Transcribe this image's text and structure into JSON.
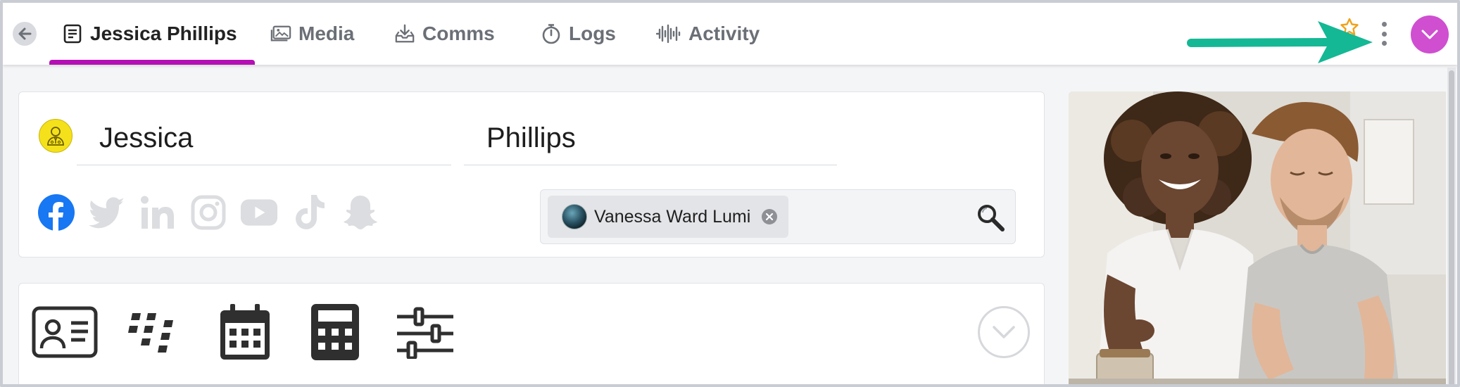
{
  "tabs": [
    {
      "label": "Jessica Phillips",
      "icon": "document-icon",
      "active": true
    },
    {
      "label": "Media",
      "icon": "image-icon",
      "active": false
    },
    {
      "label": "Comms",
      "icon": "inbox-download-icon",
      "active": false
    },
    {
      "label": "Logs",
      "icon": "stopwatch-icon",
      "active": false
    },
    {
      "label": "Activity",
      "icon": "waveform-icon",
      "active": false
    }
  ],
  "contact": {
    "first_name": "Jessica",
    "last_name": "Phillips"
  },
  "social_networks": [
    "facebook",
    "twitter",
    "linkedin",
    "instagram",
    "youtube",
    "tiktok",
    "snapchat"
  ],
  "linked_contact": {
    "name": "Vanessa Ward Lumi"
  },
  "tools": [
    "id-card-icon",
    "blackberry-icon",
    "calendar-icon",
    "calculator-icon",
    "sliders-icon"
  ],
  "colors": {
    "accent": "#b40fb4",
    "avatar_button": "#cf4fd0",
    "contact_icon": "#f4e11b",
    "facebook": "#1877f2",
    "annotation_arrow": "#14b894"
  }
}
